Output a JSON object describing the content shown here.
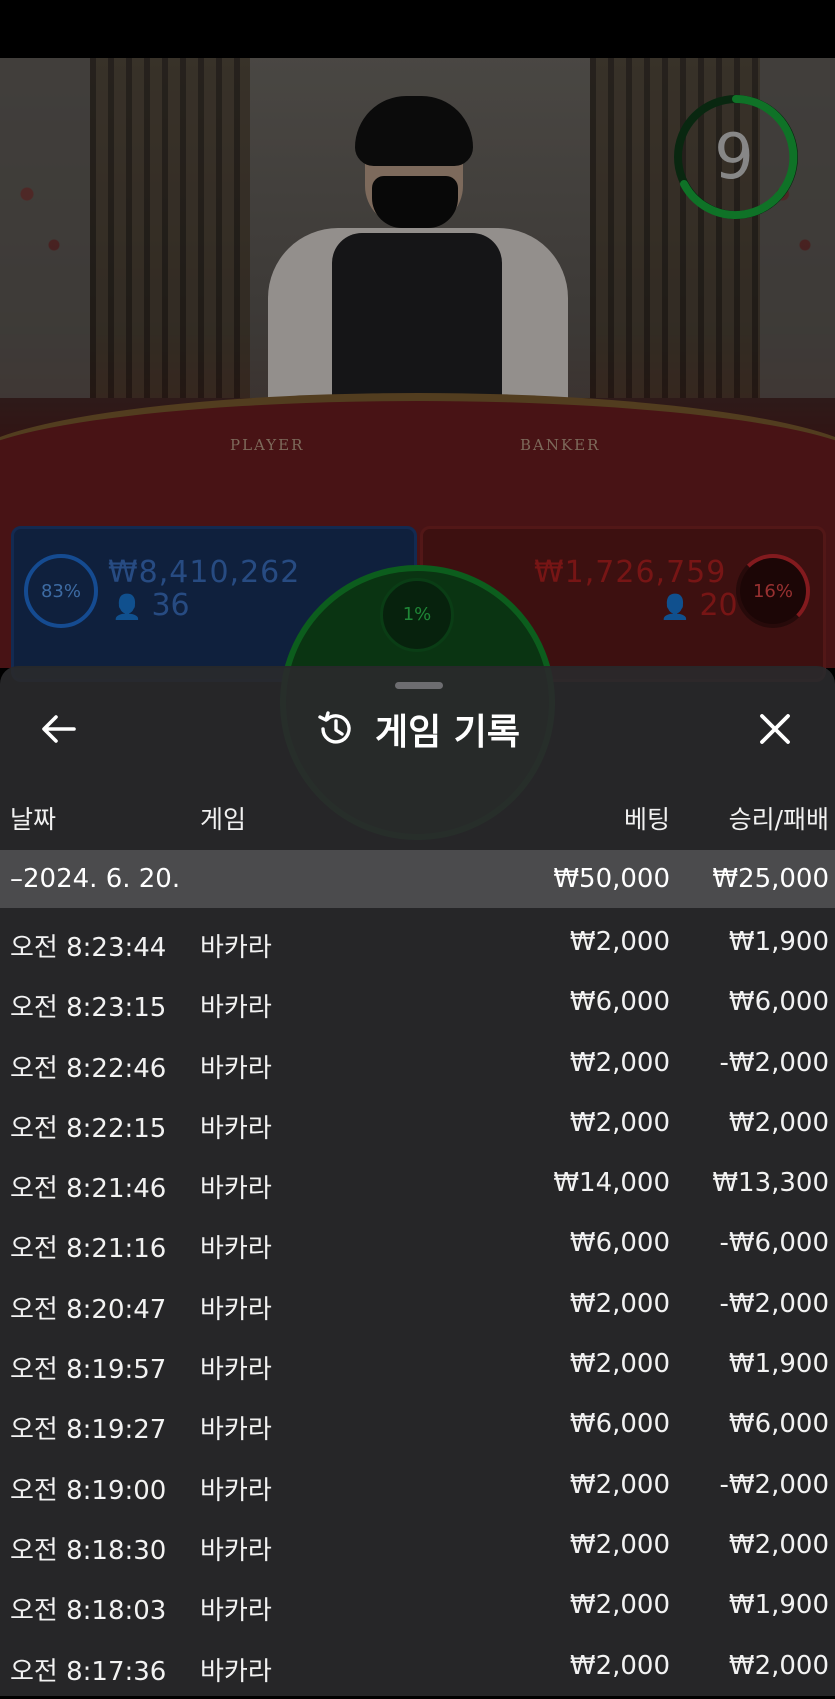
{
  "live": {
    "timer": "9",
    "table_labels": {
      "player": "PLAYER",
      "banker": "BANKER"
    },
    "player": {
      "percent": "83%",
      "amount": "₩8,410,262",
      "count": "36"
    },
    "banker": {
      "percent": "16%",
      "amount": "₩1,726,759",
      "count": "20"
    },
    "tie": {
      "percent": "1%"
    },
    "colors": {
      "player": "#1f6fd6",
      "banker": "#c1272d",
      "tie": "#138a2b"
    }
  },
  "sheet": {
    "title": "게임 기록",
    "icons": {
      "back": "arrow-left-icon",
      "history": "history-icon",
      "close": "close-icon"
    },
    "columns": {
      "date": "날짜",
      "game": "게임",
      "bet": "베팅",
      "win_loss": "승리/패배"
    },
    "summary": {
      "date": "–2024. 6. 20.",
      "bet": "₩50,000",
      "win_loss": "₩25,000"
    },
    "rows": [
      {
        "time": "오전 8:23:44",
        "game": "바카라",
        "bet": "₩2,000",
        "win_loss": "₩1,900"
      },
      {
        "time": "오전 8:23:15",
        "game": "바카라",
        "bet": "₩6,000",
        "win_loss": "₩6,000"
      },
      {
        "time": "오전 8:22:46",
        "game": "바카라",
        "bet": "₩2,000",
        "win_loss": "-₩2,000"
      },
      {
        "time": "오전 8:22:15",
        "game": "바카라",
        "bet": "₩2,000",
        "win_loss": "₩2,000"
      },
      {
        "time": "오전 8:21:46",
        "game": "바카라",
        "bet": "₩14,000",
        "win_loss": "₩13,300"
      },
      {
        "time": "오전 8:21:16",
        "game": "바카라",
        "bet": "₩6,000",
        "win_loss": "-₩6,000"
      },
      {
        "time": "오전 8:20:47",
        "game": "바카라",
        "bet": "₩2,000",
        "win_loss": "-₩2,000"
      },
      {
        "time": "오전 8:19:57",
        "game": "바카라",
        "bet": "₩2,000",
        "win_loss": "₩1,900"
      },
      {
        "time": "오전 8:19:27",
        "game": "바카라",
        "bet": "₩6,000",
        "win_loss": "₩6,000"
      },
      {
        "time": "오전 8:19:00",
        "game": "바카라",
        "bet": "₩2,000",
        "win_loss": "-₩2,000"
      },
      {
        "time": "오전 8:18:30",
        "game": "바카라",
        "bet": "₩2,000",
        "win_loss": "₩2,000"
      },
      {
        "time": "오전 8:18:03",
        "game": "바카라",
        "bet": "₩2,000",
        "win_loss": "₩1,900"
      },
      {
        "time": "오전 8:17:36",
        "game": "바카라",
        "bet": "₩2,000",
        "win_loss": "₩2,000"
      }
    ]
  }
}
